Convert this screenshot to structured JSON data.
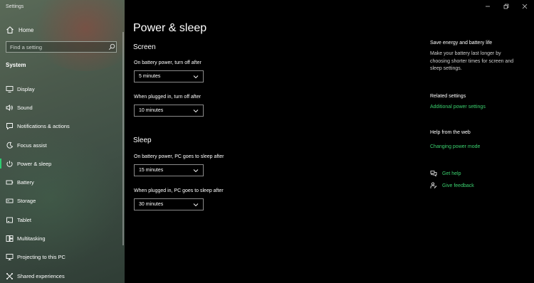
{
  "window": {
    "title": "Settings"
  },
  "sidebar": {
    "home_label": "Home",
    "search_placeholder": "Find a setting",
    "section_label": "System",
    "items": [
      {
        "label": "Display",
        "icon": "display-icon"
      },
      {
        "label": "Sound",
        "icon": "sound-icon"
      },
      {
        "label": "Notifications & actions",
        "icon": "notifications-icon"
      },
      {
        "label": "Focus assist",
        "icon": "focus-assist-icon"
      },
      {
        "label": "Power & sleep",
        "icon": "power-icon",
        "active": true
      },
      {
        "label": "Battery",
        "icon": "battery-icon"
      },
      {
        "label": "Storage",
        "icon": "storage-icon"
      },
      {
        "label": "Tablet",
        "icon": "tablet-icon"
      },
      {
        "label": "Multitasking",
        "icon": "multitasking-icon"
      },
      {
        "label": "Projecting to this PC",
        "icon": "projecting-icon"
      },
      {
        "label": "Shared experiences",
        "icon": "shared-experiences-icon"
      }
    ]
  },
  "main": {
    "title": "Power & sleep",
    "screen": {
      "heading": "Screen",
      "battery_label": "On battery power, turn off after",
      "battery_value": "5 minutes",
      "plugged_label": "When plugged in, turn off after",
      "plugged_value": "10 minutes"
    },
    "sleep": {
      "heading": "Sleep",
      "battery_label": "On battery power, PC goes to sleep after",
      "battery_value": "15 minutes",
      "plugged_label": "When plugged in, PC goes to sleep after",
      "plugged_value": "30 minutes"
    }
  },
  "right_panel": {
    "save_heading": "Save energy and battery life",
    "save_text": "Make your battery last longer by choosing shorter times for screen and sleep settings.",
    "related_heading": "Related settings",
    "related_link": "Additional power settings",
    "web_heading": "Help from the web",
    "web_link": "Changing power mode",
    "get_help": "Get help",
    "give_feedback": "Give feedback"
  },
  "colors": {
    "accent": "#3bd16f",
    "background": "#000000"
  }
}
